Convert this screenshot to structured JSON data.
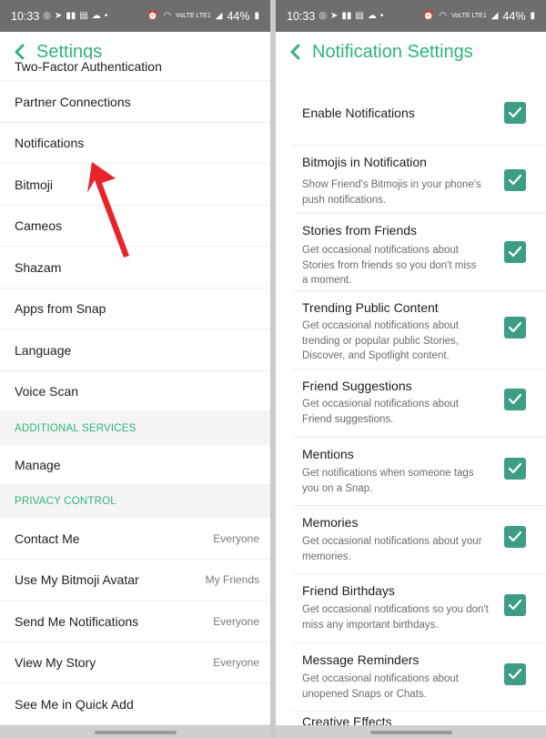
{
  "status_bar": {
    "time": "10:33",
    "battery": "44%",
    "network": "VoLTE LTE1"
  },
  "left": {
    "header": {
      "title": "Settings"
    },
    "partial_top_item": "Two-Factor Authentication",
    "items": [
      {
        "label": "Partner Connections"
      },
      {
        "label": "Notifications"
      },
      {
        "label": "Bitmoji"
      },
      {
        "label": "Cameos"
      },
      {
        "label": "Shazam"
      },
      {
        "label": "Apps from Snap"
      },
      {
        "label": "Language"
      },
      {
        "label": "Voice Scan"
      }
    ],
    "section_additional": "ADDITIONAL SERVICES",
    "manage": "Manage",
    "section_privacy": "PRIVACY CONTROL",
    "privacy_items": [
      {
        "label": "Contact Me",
        "value": "Everyone"
      },
      {
        "label": "Use My Bitmoji Avatar",
        "value": "My Friends"
      },
      {
        "label": "Send Me Notifications",
        "value": "Everyone"
      },
      {
        "label": "View My Story",
        "value": "Everyone"
      },
      {
        "label": "See Me in Quick Add",
        "value": ""
      }
    ],
    "annotation_arrow_color": "#e8232a"
  },
  "right": {
    "header": {
      "title": "Notification Settings"
    },
    "enable": {
      "label": "Enable Notifications",
      "checked": true
    },
    "rows": [
      {
        "title": "Bitmojis in Notification",
        "desc": "Show Friend's Bitmojis in your phone's push notifications.",
        "checked": true
      },
      {
        "title": "Stories from Friends",
        "desc": "Get occasional notifications about Stories from friends so you don't miss a moment.",
        "checked": true
      },
      {
        "title": "Trending Public Content",
        "desc": "Get occasional notifications about trending or popular public Stories, Discover, and Spotlight content.",
        "checked": true
      },
      {
        "title": "Friend Suggestions",
        "desc": "Get occasional notifications about Friend suggestions.",
        "checked": true
      },
      {
        "title": "Mentions",
        "desc": "Get notifications when someone tags you on a Snap.",
        "checked": true
      },
      {
        "title": "Memories",
        "desc": "Get occasional notifications about your memories.",
        "checked": true
      },
      {
        "title": "Friend Birthdays",
        "desc": "Get occasional notifications so you don't miss any important birthdays.",
        "checked": true
      },
      {
        "title": "Message Reminders",
        "desc": "Get occasional notifications about unopened Snaps or Chats.",
        "checked": true
      }
    ],
    "partial_bottom": "Creative Effects"
  },
  "colors": {
    "accent": "#2fb37c",
    "checkbox": "#3d9e85",
    "status_bar": "#6e6e6e"
  }
}
